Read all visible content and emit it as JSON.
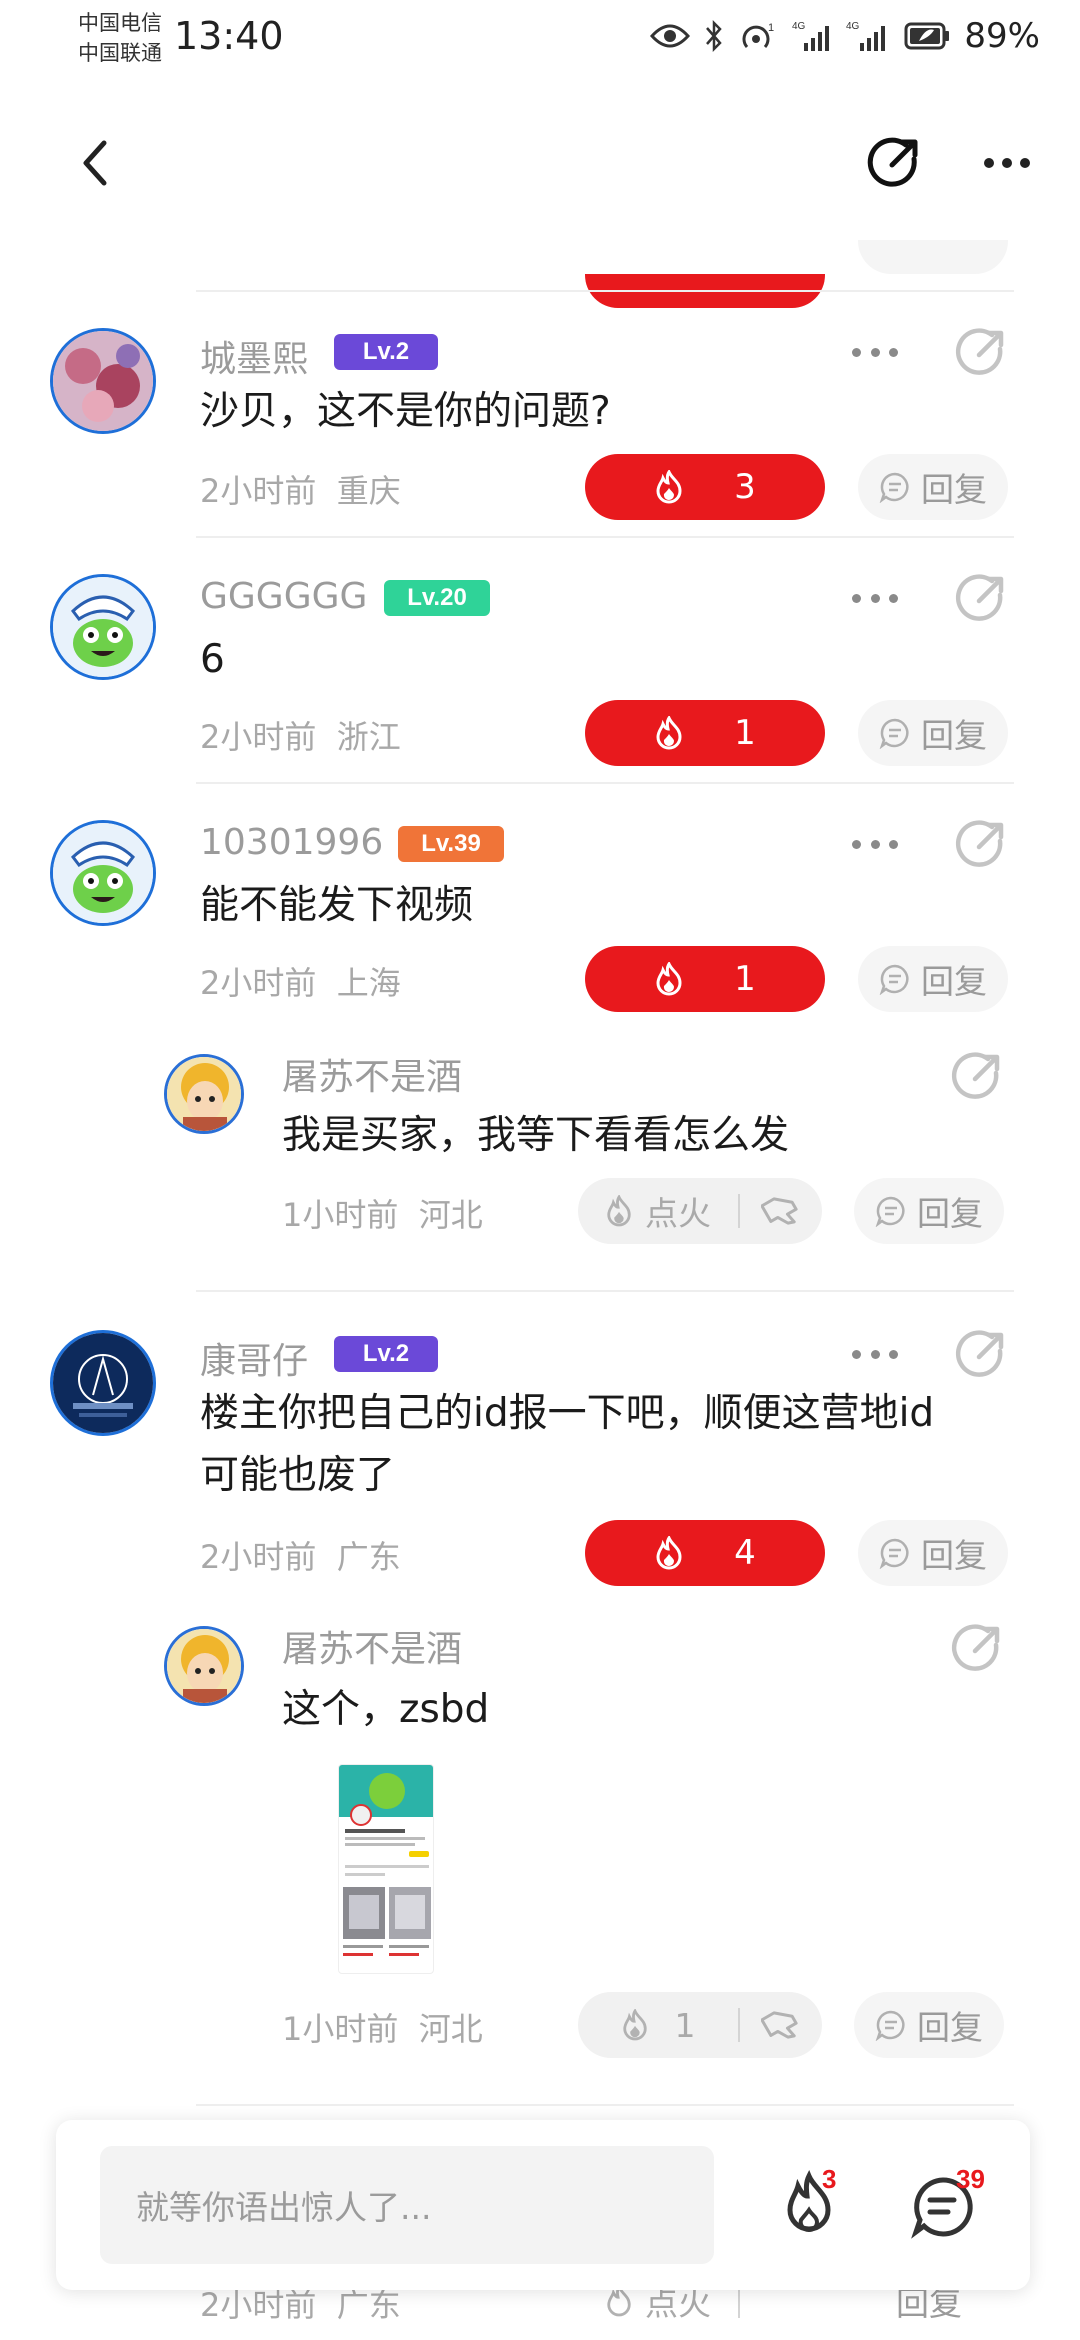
{
  "status_bar": {
    "carrier1": "中国电信",
    "carrier2": "中国联通",
    "time": "13:40",
    "net1": "4G",
    "net2": "4G",
    "battery": "89%"
  },
  "icons": {
    "back": "chevron-left-icon",
    "share": "share-icon",
    "more": "more-dots-icon",
    "fire": "fire-icon",
    "reply": "reply-bubble-icon",
    "dislike": "thumbs-down-icon"
  },
  "colors": {
    "accent_red": "#e8191d",
    "lv_purple": "#6b49d8",
    "lv_green": "#2fd398",
    "lv_orange": "#f07438"
  },
  "comments": [
    {
      "user": "城墨熙",
      "level": "Lv.2",
      "text": "沙贝，这不是你的问题?",
      "time": "2小时前",
      "location": "重庆",
      "fire": "3",
      "reply": "回复"
    },
    {
      "user": "GGGGGG",
      "level": "Lv.20",
      "text": "6",
      "time": "2小时前",
      "location": "浙江",
      "fire": "1",
      "reply": "回复"
    },
    {
      "user": "10301996",
      "level": "Lv.39",
      "text": "能不能发下视频",
      "time": "2小时前",
      "location": "上海",
      "fire": "1",
      "reply": "回复"
    },
    {
      "user": "康哥仔",
      "level": "Lv.2",
      "text1": "楼主你把自己的id报一下吧，顺便这营地id",
      "text2": "可能也废了",
      "time": "2小时前",
      "location": "广东",
      "fire": "4",
      "reply": "回复"
    }
  ],
  "replies": [
    {
      "user": "屠苏不是酒",
      "text": "我是买家，我等下看看怎么发",
      "time": "1小时前",
      "location": "河北",
      "fire_label": "点火",
      "reply": "回复"
    },
    {
      "user": "屠苏不是酒",
      "text": "这个，zsbd",
      "time": "1小时前",
      "location": "河北",
      "fire_label": "1",
      "reply": "回复"
    }
  ],
  "partial_bottom": {
    "time": "2小时前",
    "location": "广东",
    "fire_label": "点火",
    "reply": "回复"
  },
  "bottom_bar": {
    "placeholder": "就等你语出惊人了...",
    "fire_count": "3",
    "comment_count": "39"
  }
}
